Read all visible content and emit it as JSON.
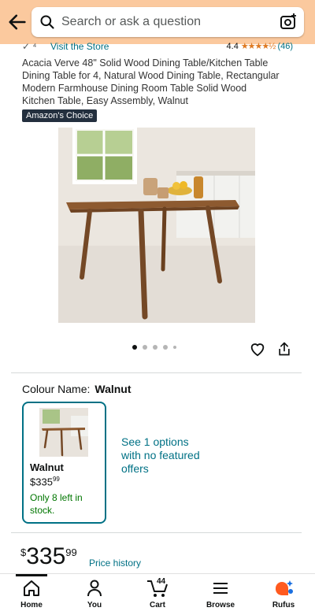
{
  "search": {
    "placeholder": "Search or ask a question"
  },
  "store": {
    "visit_label": "Visit the Store",
    "rating_value": "4.4",
    "stars": "★★★★½",
    "rating_count": "(46)"
  },
  "product": {
    "title": "Acacia Verve 48\" Solid Wood Dining Table/Kitchen Table Dining Table for 4, Natural Wood Dining Table, Rectangular Modern Farmhouse Dining Room Table Solid Wood Kitchen Table, Easy Assembly, Walnut",
    "badge": "Amazon's Choice"
  },
  "gallery": {
    "active_index": 0,
    "count": 5
  },
  "colour": {
    "label": "Colour Name:",
    "value": "Walnut",
    "swatch": {
      "name": "Walnut",
      "price_whole": "335",
      "price_fraction": "99",
      "currency": "$",
      "stock": "Only 8 left in stock."
    },
    "see_options": "See 1 options with no featured offers"
  },
  "price": {
    "currency": "$",
    "whole": "335",
    "fraction": "99",
    "history_label": "Price history"
  },
  "tabs": [
    {
      "label": "Home",
      "icon": "home-icon"
    },
    {
      "label": "You",
      "icon": "person-icon"
    },
    {
      "label": "Cart",
      "icon": "cart-icon",
      "count": "44"
    },
    {
      "label": "Browse",
      "icon": "menu-icon"
    },
    {
      "label": "Rufus",
      "icon": "rufus-icon"
    }
  ],
  "colors": {
    "topbar": "#fbc99e",
    "link": "#007185",
    "stock": "#007600",
    "star": "#de7921"
  }
}
